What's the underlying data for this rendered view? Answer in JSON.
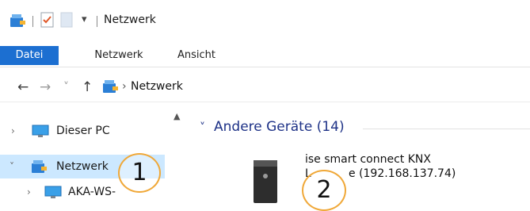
{
  "window": {
    "title": "Netzwerk"
  },
  "quick_access": {
    "icons": [
      "network-folder-icon",
      "properties-check-icon",
      "new-folder-icon",
      "dropdown-arrow-icon"
    ],
    "dropdown_glyph": "▾"
  },
  "ribbon": {
    "tabs": [
      {
        "label": "Datei",
        "active": true
      },
      {
        "label": "Netzwerk"
      },
      {
        "label": "Ansicht"
      }
    ],
    "accent_color": "#1c6fd1"
  },
  "navigation": {
    "back_glyph": "←",
    "forward_glyph": "→",
    "recent_glyph": "˅",
    "up_glyph": "↑",
    "breadcrumb_sep": "›",
    "address": "Netzwerk"
  },
  "sidebar": {
    "items": [
      {
        "label": "Dieser PC",
        "icon": "monitor-icon",
        "expanded": false,
        "selected": false
      },
      {
        "label": "Netzwerk",
        "icon": "network-icon",
        "expanded": true,
        "selected": true
      },
      {
        "label": "AKA-WS-",
        "icon": "monitor-icon",
        "expanded": false,
        "selected": false
      }
    ],
    "selection_color": "#cce8ff"
  },
  "content": {
    "group": {
      "title": "Andere Geräte (14)",
      "collapsed": false
    },
    "device": {
      "name_line1": "ise smart connect KNX",
      "name_line2_prefix": "L",
      "name_line2_suffix": "e (192.168.137.74)",
      "icon": "server-device-icon"
    }
  },
  "callouts": [
    {
      "label": "1"
    },
    {
      "label": "2"
    }
  ],
  "colors": {
    "callout_border": "#f0a838",
    "group_title": "#1e3287"
  }
}
